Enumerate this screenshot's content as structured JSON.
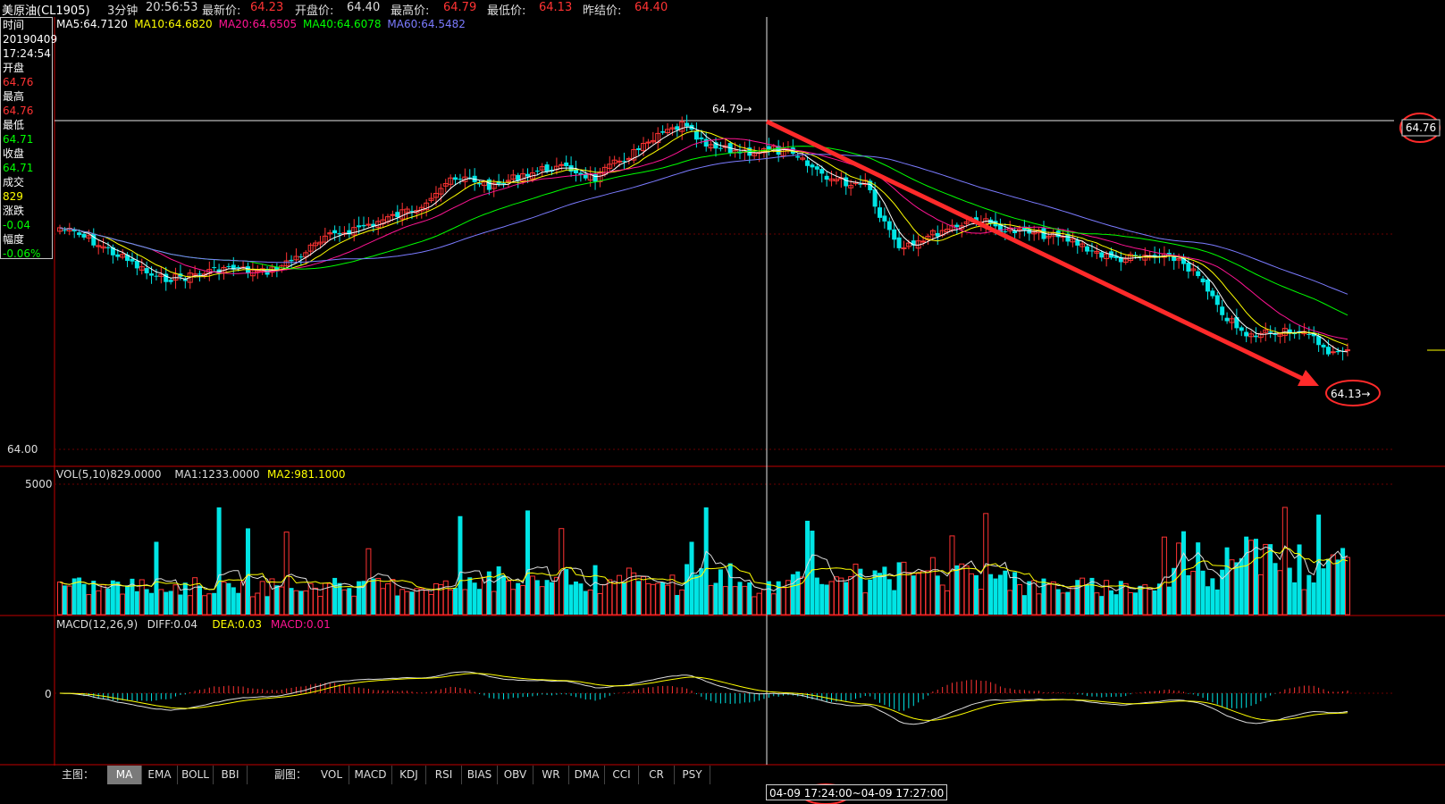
{
  "header": {
    "instrument": "美原油(CL1905)",
    "period": "3分钟",
    "time": "20:56:53",
    "latest_label": "最新价:",
    "latest_value": "64.23",
    "open_label": "开盘价:",
    "open_value": "64.40",
    "high_label": "最高价:",
    "high_value": "64.79",
    "low_label": "最低价:",
    "low_value": "64.13",
    "prev_close_label": "昨结价:",
    "prev_close_value": "64.40"
  },
  "info_panel": {
    "time_label": "时间",
    "date": "20190409",
    "time": "17:24:54",
    "open_label": "开盘",
    "open": "64.76",
    "high_label": "最高",
    "high": "64.76",
    "low_label": "最低",
    "low": "64.71",
    "close_label": "收盘",
    "close": "64.71",
    "volume_label": "成交",
    "volume": "829",
    "change_label": "涨跌",
    "change": "-0.04",
    "amplitude_label": "幅度",
    "amplitude": "-0.06%"
  },
  "main_chart": {
    "ma_legend": [
      "MA5:64.7120",
      "MA10:64.6820",
      "MA20:64.6505",
      "MA40:64.6078",
      "MA60:64.5482"
    ],
    "ma_colors": [
      "#ffffff",
      "#ffff00",
      "#ff1493",
      "#00ff00",
      "#7b7bff"
    ],
    "y_label_bottom": "64.00",
    "crosshair_price": "64.76",
    "high_marker": "64.79",
    "low_marker": "64.13"
  },
  "volume_chart": {
    "legend": [
      "VOL(5,10)829.0000",
      "MA1:1233.0000",
      "MA2:981.1000"
    ],
    "legend_colors": [
      "#dddddd",
      "#dddddd",
      "#ffff00"
    ],
    "y_label_top": "5000"
  },
  "macd_chart": {
    "legend": [
      "MACD(12,26,9)",
      "DIFF:0.04",
      "DEA:0.03",
      "MACD:0.01"
    ],
    "legend_colors": [
      "#dddddd",
      "#dddddd",
      "#ffff00",
      "#ff1493"
    ],
    "y_label_zero": "0"
  },
  "tabs": {
    "main_label": "主图：",
    "main": [
      "MA",
      "EMA",
      "BOLL",
      "BBI"
    ],
    "sub_label": "副图：",
    "sub": [
      "VOL",
      "MACD",
      "KDJ",
      "RSI",
      "BIAS",
      "OBV",
      "WR",
      "DMA",
      "CCI",
      "CR",
      "PSY"
    ]
  },
  "time_range": {
    "start_date": "04-09",
    "start_time": "17:24:00",
    "end": "~04-09 17:27:00"
  },
  "colors": {
    "up": "#ff3333",
    "down": "#00e5e5",
    "axis_red": "#c00000",
    "annotation_red": "#ff2a2a"
  }
}
